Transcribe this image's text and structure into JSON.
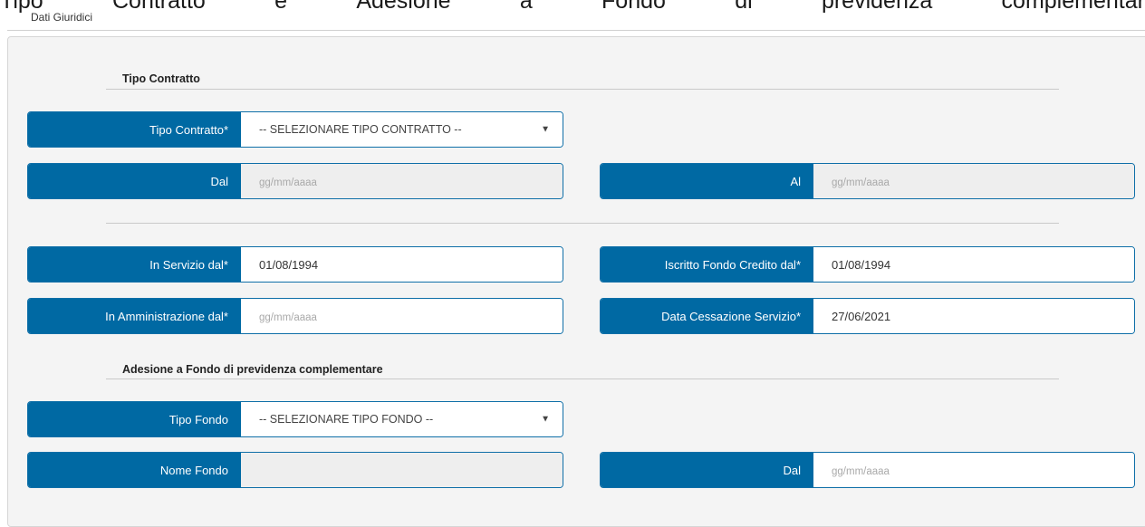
{
  "header": {
    "partial_title_words": [
      "Tipo",
      "Contratto",
      "e",
      "Adesione",
      "a",
      "Fondo",
      "di",
      "previdenza",
      "complementar"
    ],
    "tab_label": "Dati Giuridici"
  },
  "sections": {
    "contract": {
      "title": "Tipo Contratto"
    },
    "pension": {
      "title": "Adesione a Fondo di previdenza complementare"
    }
  },
  "fields": {
    "tipo_contratto": {
      "label": "Tipo Contratto*",
      "value": "-- SELEZIONARE TIPO CONTRATTO --"
    },
    "dal": {
      "label": "Dal",
      "placeholder": "gg/mm/aaaa"
    },
    "al": {
      "label": "Al",
      "placeholder": "gg/mm/aaaa"
    },
    "in_servizio": {
      "label": "In Servizio dal*",
      "value": "01/08/1994"
    },
    "iscritto_fondo": {
      "label": "Iscritto Fondo Credito dal*",
      "value": "01/08/1994"
    },
    "in_amministrazione": {
      "label": "In Amministrazione dal*",
      "placeholder": "gg/mm/aaaa"
    },
    "data_cessazione": {
      "label": "Data Cessazione Servizio*",
      "value": "27/06/2021"
    },
    "tipo_fondo": {
      "label": "Tipo Fondo",
      "value": "-- SELEZIONARE TIPO FONDO --"
    },
    "nome_fondo": {
      "label": "Nome Fondo",
      "value": ""
    },
    "fondo_dal": {
      "label": "Dal",
      "placeholder": "gg/mm/aaaa"
    }
  },
  "icons": {
    "dropdown": "caret-down-icon"
  },
  "colors": {
    "label_bg": "#0069a3",
    "panel_bg": "#f4f4f4",
    "disabled_bg": "#eeeeee"
  }
}
